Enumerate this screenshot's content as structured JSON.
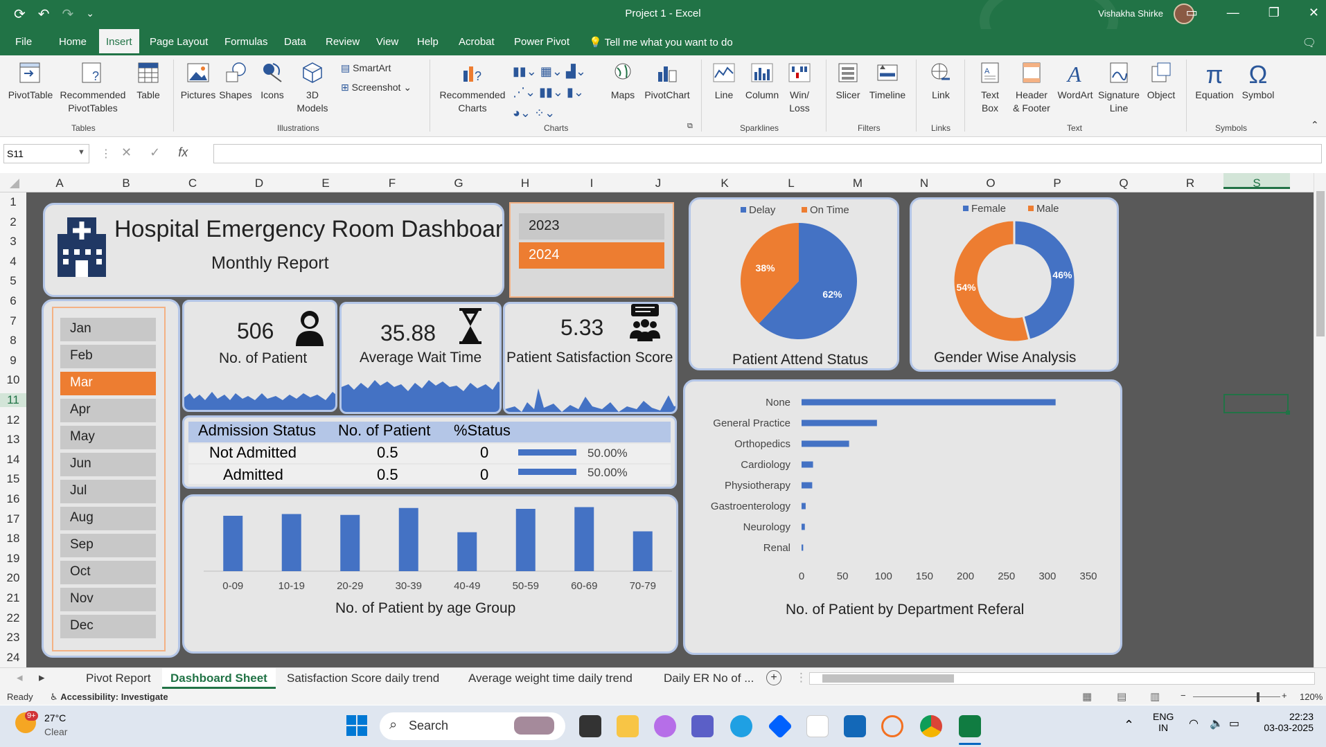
{
  "titlebar": {
    "title": "Project 1  -  Excel",
    "user": "Vishakha Shirke"
  },
  "menu": {
    "tabs": [
      "File",
      "Home",
      "Insert",
      "Page Layout",
      "Formulas",
      "Data",
      "Review",
      "View",
      "Help",
      "Acrobat",
      "Power Pivot"
    ],
    "tell": "Tell me what you want to do"
  },
  "ribbon": {
    "pivot": "PivotTable",
    "recpivot1": "Recommended",
    "recpivot2": "PivotTables",
    "table": "Table",
    "grp_tables": "Tables",
    "pictures": "Pictures",
    "shapes": "Shapes",
    "icons": "Icons",
    "models1": "3D",
    "models2": "Models",
    "smartart": "SmartArt",
    "screenshot": "Screenshot",
    "grp_illus": "Illustrations",
    "reccharts1": "Recommended",
    "reccharts2": "Charts",
    "maps": "Maps",
    "pivotchart": "PivotChart",
    "grp_charts": "Charts",
    "line": "Line",
    "column": "Column",
    "winloss1": "Win/",
    "winloss2": "Loss",
    "grp_spark": "Sparklines",
    "slicer": "Slicer",
    "timeline": "Timeline",
    "grp_filters": "Filters",
    "link": "Link",
    "grp_links": "Links",
    "textbox1": "Text",
    "textbox2": "Box",
    "hf1": "Header",
    "hf2": "& Footer",
    "wordart": "WordArt",
    "sig1": "Signature",
    "sig2": "Line",
    "object": "Object",
    "grp_text": "Text",
    "equation": "Equation",
    "symbol": "Symbol",
    "grp_symbols": "Symbols"
  },
  "formula": {
    "namebox": "S11",
    "fx": "fx"
  },
  "columns": [
    "A",
    "B",
    "C",
    "D",
    "E",
    "F",
    "G",
    "H",
    "I",
    "J",
    "K",
    "L",
    "M",
    "N",
    "O",
    "P",
    "Q",
    "R",
    "S"
  ],
  "rows": [
    "1",
    "2",
    "3",
    "4",
    "5",
    "6",
    "7",
    "8",
    "9",
    "10",
    "11",
    "12",
    "13",
    "14",
    "15",
    "16",
    "17",
    "18",
    "19",
    "20",
    "21",
    "22",
    "23",
    "24"
  ],
  "dashboard": {
    "title": "Hospital Emergency Room Dashboard",
    "subtitle": "Monthly Report",
    "years": [
      "2023",
      "2024"
    ],
    "selected_year": "2024",
    "months": [
      "Jan",
      "Feb",
      "Mar",
      "Apr",
      "May",
      "Jun",
      "Jul",
      "Aug",
      "Sep",
      "Oct",
      "Nov",
      "Dec"
    ],
    "selected_month": "Mar",
    "kpi": {
      "patients": {
        "value": "506",
        "label": "No. of Patient"
      },
      "wait": {
        "value": "35.88",
        "label": "Average Wait Time"
      },
      "satisfaction": {
        "value": "5.33",
        "label": "Patient Satisfaction Score"
      }
    },
    "admission": {
      "headers": [
        "Admission Status",
        "No. of Patient",
        "%Status"
      ],
      "rows": [
        {
          "status": "Not Admitted",
          "count": "0.5",
          "pct": "0",
          "bar": "50.00%"
        },
        {
          "status": "Admitted",
          "count": "0.5",
          "pct": "0",
          "bar": "50.00%"
        }
      ]
    },
    "colors": {
      "blue": "#4472c4",
      "orange": "#ed7d31",
      "card": "#e6e6e6",
      "border": "#b4c6e7",
      "excel_green": "#217346"
    }
  },
  "chart_data": [
    {
      "type": "pie",
      "title": "Patient Attend Status",
      "legend": [
        "Delay",
        "On Time"
      ],
      "values": [
        62,
        38
      ],
      "labels": [
        "62%",
        "38%"
      ],
      "colors": [
        "#4472c4",
        "#ed7d31"
      ],
      "legend_position": "top"
    },
    {
      "type": "pie",
      "subtype": "doughnut",
      "title": "Gender Wise Analysis",
      "legend": [
        "Female",
        "Male"
      ],
      "values": [
        46,
        54
      ],
      "labels": [
        "46%",
        "54%"
      ],
      "colors": [
        "#4472c4",
        "#ed7d31"
      ],
      "legend_position": "top"
    },
    {
      "type": "bar",
      "title": "No. of Patient by age Group",
      "categories": [
        "0-09",
        "10-19",
        "20-29",
        "30-39",
        "40-49",
        "50-59",
        "60-69",
        "70-79"
      ],
      "values": [
        64,
        66,
        65,
        73,
        45,
        72,
        74,
        46
      ],
      "ylim": [
        0,
        80
      ]
    },
    {
      "type": "bar",
      "orientation": "horizontal",
      "title": "No. of Patient by Department Referal",
      "categories": [
        "None",
        "General Practice",
        "Orthopedics",
        "Cardiology",
        "Physiotherapy",
        "Gastroenterology",
        "Neurology",
        "Renal"
      ],
      "values": [
        310,
        92,
        58,
        14,
        13,
        5,
        4,
        2
      ],
      "xticks": [
        "0",
        "50",
        "100",
        "150",
        "200",
        "250",
        "300",
        "350"
      ],
      "xlim": [
        0,
        350
      ]
    }
  ],
  "sheets": [
    "Pivot Report",
    "Dashboard Sheet",
    "Satisfaction Score daily trend",
    "Average weight time daily trend",
    "Daily ER No of ..."
  ],
  "active_sheet": "Dashboard Sheet",
  "status": {
    "ready": "Ready",
    "accessibility": "Accessibility: Investigate",
    "zoom": "120%"
  },
  "taskbar": {
    "temp": "27°C",
    "weather": "Clear",
    "badge": "9+",
    "search": "Search",
    "lang1": "ENG",
    "lang2": "IN",
    "time": "22:23",
    "date": "03-03-2025"
  }
}
